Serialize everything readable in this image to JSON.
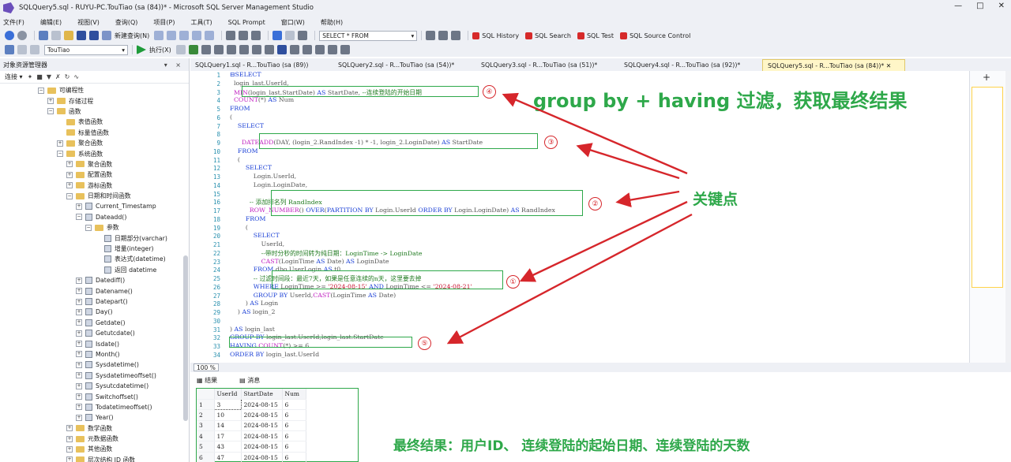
{
  "window": {
    "title": "SQLQuery5.sql - RUYU-PC.TouTiao (sa (84))* - Microsoft SQL Server Management Studio",
    "controls": [
      "—",
      "□",
      "✕"
    ]
  },
  "menu": [
    "文件(F)",
    "编辑(E)",
    "视图(V)",
    "查询(Q)",
    "项目(P)",
    "工具(T)",
    "SQL Prompt",
    "窗口(W)",
    "帮助(H)"
  ],
  "toolbar": {
    "new_query": "新建查询(N)",
    "snippet_combo": "SELECT * FROM",
    "database": "TouTiao",
    "execute": "执行(X)",
    "sql_buttons": [
      "SQL History",
      "SQL Search",
      "SQL Test",
      "SQL Source Control"
    ]
  },
  "explorer": {
    "title": "对象资源管理器",
    "pins": "▾ ×",
    "connect": "连接 ▾",
    "tree": [
      {
        "label": "可编程性",
        "indent": 0,
        "exp": "−",
        "icon": "folder"
      },
      {
        "label": "存储过程",
        "indent": 1,
        "exp": "+",
        "icon": "folder"
      },
      {
        "label": "函数",
        "indent": 1,
        "exp": "−",
        "icon": "folder"
      },
      {
        "label": "表值函数",
        "indent": 2,
        "exp": "",
        "icon": "folder"
      },
      {
        "label": "标量值函数",
        "indent": 2,
        "exp": "",
        "icon": "folder"
      },
      {
        "label": "聚合函数",
        "indent": 2,
        "exp": "+",
        "icon": "folder"
      },
      {
        "label": "系统函数",
        "indent": 2,
        "exp": "−",
        "icon": "folder"
      },
      {
        "label": "聚合函数",
        "indent": 3,
        "exp": "+",
        "icon": "folder"
      },
      {
        "label": "配置函数",
        "indent": 3,
        "exp": "+",
        "icon": "folder"
      },
      {
        "label": "游标函数",
        "indent": 3,
        "exp": "+",
        "icon": "folder"
      },
      {
        "label": "日期和时间函数",
        "indent": 3,
        "exp": "−",
        "icon": "folder"
      },
      {
        "label": "Current_Timestamp",
        "indent": 4,
        "exp": "+",
        "icon": "fn"
      },
      {
        "label": "Dateadd()",
        "indent": 4,
        "exp": "−",
        "icon": "fn"
      },
      {
        "label": "参数",
        "indent": 5,
        "exp": "−",
        "icon": "folder"
      },
      {
        "label": "日期部分(varchar)",
        "indent": 6,
        "exp": "",
        "icon": "fn"
      },
      {
        "label": "增量(integer)",
        "indent": 6,
        "exp": "",
        "icon": "fn"
      },
      {
        "label": "表达式(datetime)",
        "indent": 6,
        "exp": "",
        "icon": "fn"
      },
      {
        "label": "返回 datetime",
        "indent": 6,
        "exp": "",
        "icon": "fn"
      },
      {
        "label": "Datediff()",
        "indent": 4,
        "exp": "+",
        "icon": "fn"
      },
      {
        "label": "Datename()",
        "indent": 4,
        "exp": "+",
        "icon": "fn"
      },
      {
        "label": "Datepart()",
        "indent": 4,
        "exp": "+",
        "icon": "fn"
      },
      {
        "label": "Day()",
        "indent": 4,
        "exp": "+",
        "icon": "fn"
      },
      {
        "label": "Getdate()",
        "indent": 4,
        "exp": "+",
        "icon": "fn"
      },
      {
        "label": "Getutcdate()",
        "indent": 4,
        "exp": "+",
        "icon": "fn"
      },
      {
        "label": "Isdate()",
        "indent": 4,
        "exp": "+",
        "icon": "fn"
      },
      {
        "label": "Month()",
        "indent": 4,
        "exp": "+",
        "icon": "fn"
      },
      {
        "label": "Sysdatetime()",
        "indent": 4,
        "exp": "+",
        "icon": "fn"
      },
      {
        "label": "Sysdatetimeoffset()",
        "indent": 4,
        "exp": "+",
        "icon": "fn"
      },
      {
        "label": "Sysutcdatetime()",
        "indent": 4,
        "exp": "+",
        "icon": "fn"
      },
      {
        "label": "Switchoffset()",
        "indent": 4,
        "exp": "+",
        "icon": "fn"
      },
      {
        "label": "Todatetimeoffset()",
        "indent": 4,
        "exp": "+",
        "icon": "fn"
      },
      {
        "label": "Year()",
        "indent": 4,
        "exp": "+",
        "icon": "fn"
      },
      {
        "label": "数学函数",
        "indent": 3,
        "exp": "+",
        "icon": "folder"
      },
      {
        "label": "元数据函数",
        "indent": 3,
        "exp": "+",
        "icon": "folder"
      },
      {
        "label": "其他函数",
        "indent": 3,
        "exp": "+",
        "icon": "folder"
      },
      {
        "label": "层次结构 ID 函数",
        "indent": 3,
        "exp": "+",
        "icon": "folder"
      }
    ]
  },
  "tabs": [
    {
      "label": "SQLQuery1.sql - R...TouTiao (sa (89))",
      "active": false
    },
    {
      "label": "SQLQuery2.sql - R...TouTiao (sa (54))*",
      "active": false
    },
    {
      "label": "SQLQuery3.sql - R...TouTiao (sa (51))*",
      "active": false
    },
    {
      "label": "SQLQuery4.sql - R...TouTiao (sa (92))*",
      "active": false
    },
    {
      "label": "SQLQuery5.sql - R...TouTiao (sa (84))*  ✕",
      "active": true
    }
  ],
  "code": [
    [
      {
        "t": "⊟SELECT",
        "c": "kw"
      }
    ],
    [
      {
        "t": "  login_last.UserId,",
        "c": "gr"
      }
    ],
    [
      {
        "t": "  MIN",
        "c": "fn"
      },
      {
        "t": "(login_last.StartDate) ",
        "c": "gr"
      },
      {
        "t": "AS",
        "c": "kw"
      },
      {
        "t": " StartDate, ",
        "c": "gr"
      },
      {
        "t": "--连续登陆的开始日期",
        "c": "cm"
      }
    ],
    [
      {
        "t": "  COUNT",
        "c": "fn"
      },
      {
        "t": "(*) ",
        "c": "gr"
      },
      {
        "t": "AS",
        "c": "kw"
      },
      {
        "t": " Num",
        "c": "gr"
      }
    ],
    [
      {
        "t": "FROM",
        "c": "kw"
      }
    ],
    [
      {
        "t": "(",
        "c": "gr"
      }
    ],
    [
      {
        "t": "    SELECT",
        "c": "kw"
      }
    ],
    [
      {
        "t": "",
        "c": "gr"
      }
    ],
    [
      {
        "t": "      DATEADD",
        "c": "fn"
      },
      {
        "t": "(DAY, (login_2.RandIndex -1) * -1, login_2.LoginDate) ",
        "c": "gr"
      },
      {
        "t": "AS",
        "c": "kw"
      },
      {
        "t": " StartDate",
        "c": "gr"
      }
    ],
    [
      {
        "t": "    FROM",
        "c": "kw"
      }
    ],
    [
      {
        "t": "    (",
        "c": "gr"
      }
    ],
    [
      {
        "t": "        SELECT",
        "c": "kw"
      }
    ],
    [
      {
        "t": "            Login.UserId,",
        "c": "gr"
      }
    ],
    [
      {
        "t": "            Login.LoginDate,",
        "c": "gr"
      }
    ],
    [
      {
        "t": "",
        "c": "gr"
      }
    ],
    [
      {
        "t": "          -- 添加排名列 RandIndex",
        "c": "cm"
      }
    ],
    [
      {
        "t": "          ROW_NUMBER",
        "c": "fn"
      },
      {
        "t": "() ",
        "c": "gr"
      },
      {
        "t": "OVER",
        "c": "kw"
      },
      {
        "t": "(",
        "c": "gr"
      },
      {
        "t": "PARTITION BY",
        "c": "kw"
      },
      {
        "t": " Login.UserId ",
        "c": "gr"
      },
      {
        "t": "ORDER BY",
        "c": "kw"
      },
      {
        "t": " Login.LoginDate) ",
        "c": "gr"
      },
      {
        "t": "AS",
        "c": "kw"
      },
      {
        "t": " RandIndex",
        "c": "gr"
      }
    ],
    [
      {
        "t": "        FROM",
        "c": "kw"
      }
    ],
    [
      {
        "t": "        (",
        "c": "gr"
      }
    ],
    [
      {
        "t": "            SELECT",
        "c": "kw"
      }
    ],
    [
      {
        "t": "                UserId,",
        "c": "gr"
      }
    ],
    [
      {
        "t": "                --带时分秒的时间转为纯日期：LoginTime -> LoginDate",
        "c": "cm"
      }
    ],
    [
      {
        "t": "                CAST",
        "c": "fn"
      },
      {
        "t": "(LoginTime ",
        "c": "gr"
      },
      {
        "t": "AS",
        "c": "kw"
      },
      {
        "t": " Date) ",
        "c": "gr"
      },
      {
        "t": "AS",
        "c": "kw"
      },
      {
        "t": " LoginDate",
        "c": "gr"
      }
    ],
    [
      {
        "t": "            FROM",
        "c": "kw"
      },
      {
        "t": " dbo.UserLogin ",
        "c": "gr"
      },
      {
        "t": "AS",
        "c": "kw"
      },
      {
        "t": " t0",
        "c": "gr"
      }
    ],
    [
      {
        "t": "            -- 过滤时间段：最近7天，如果是任意连续的n天，这里要去掉",
        "c": "cm"
      }
    ],
    [
      {
        "t": "            WHERE",
        "c": "kw"
      },
      {
        "t": " LoginTime >= ",
        "c": "gr"
      },
      {
        "t": "'2024-08-15'",
        "c": "str"
      },
      {
        "t": " AND",
        "c": "kw"
      },
      {
        "t": " LoginTime <= ",
        "c": "gr"
      },
      {
        "t": "'2024-08-21'",
        "c": "str"
      }
    ],
    [
      {
        "t": "            GROUP BY",
        "c": "kw"
      },
      {
        "t": " UserId,",
        "c": "gr"
      },
      {
        "t": "CAST",
        "c": "fn"
      },
      {
        "t": "(LoginTime ",
        "c": "gr"
      },
      {
        "t": "AS",
        "c": "kw"
      },
      {
        "t": " Date)",
        "c": "gr"
      }
    ],
    [
      {
        "t": "        ) ",
        "c": "gr"
      },
      {
        "t": "AS",
        "c": "kw"
      },
      {
        "t": " Login",
        "c": "gr"
      }
    ],
    [
      {
        "t": "    ) ",
        "c": "gr"
      },
      {
        "t": "AS",
        "c": "kw"
      },
      {
        "t": " login_2",
        "c": "gr"
      }
    ],
    [
      {
        "t": "",
        "c": "gr"
      }
    ],
    [
      {
        "t": ") ",
        "c": "gr"
      },
      {
        "t": "AS",
        "c": "kw"
      },
      {
        "t": " login_last",
        "c": "gr"
      }
    ],
    [
      {
        "t": "GROUP BY",
        "c": "kw"
      },
      {
        "t": " login_last.UserId,login_last.StartDate",
        "c": "gr"
      }
    ],
    [
      {
        "t": "HAVING",
        "c": "kw"
      },
      {
        "t": " COUNT",
        "c": "fn"
      },
      {
        "t": "(*) >= 6",
        "c": "gr"
      }
    ],
    [
      {
        "t": "ORDER BY",
        "c": "kw"
      },
      {
        "t": " login_last.UserId",
        "c": "gr"
      }
    ]
  ],
  "annotations": {
    "title": "group by + having 过滤，获取最终结果",
    "key_point": "关键点",
    "final_result": "最终结果：用户ID、 连续登陆的起始日期、连续登陆的天数",
    "markers": [
      "①",
      "②",
      "③",
      "④",
      "⑤"
    ]
  },
  "zoom": "100 %",
  "results_tabs": {
    "results": "结果",
    "messages": "消息"
  },
  "results": {
    "columns": [
      "UserId",
      "StartDate",
      "Num"
    ],
    "rows": [
      [
        "1",
        "3",
        "2024-08-15",
        "6"
      ],
      [
        "2",
        "10",
        "2024-08-15",
        "6"
      ],
      [
        "3",
        "14",
        "2024-08-15",
        "6"
      ],
      [
        "4",
        "17",
        "2024-08-15",
        "6"
      ],
      [
        "5",
        "43",
        "2024-08-15",
        "6"
      ],
      [
        "6",
        "47",
        "2024-08-15",
        "6"
      ]
    ]
  },
  "colors": {
    "annotation_green": "#2ea84a",
    "arrow_red": "#d6262b",
    "keyword_blue": "#1a3fd6"
  }
}
